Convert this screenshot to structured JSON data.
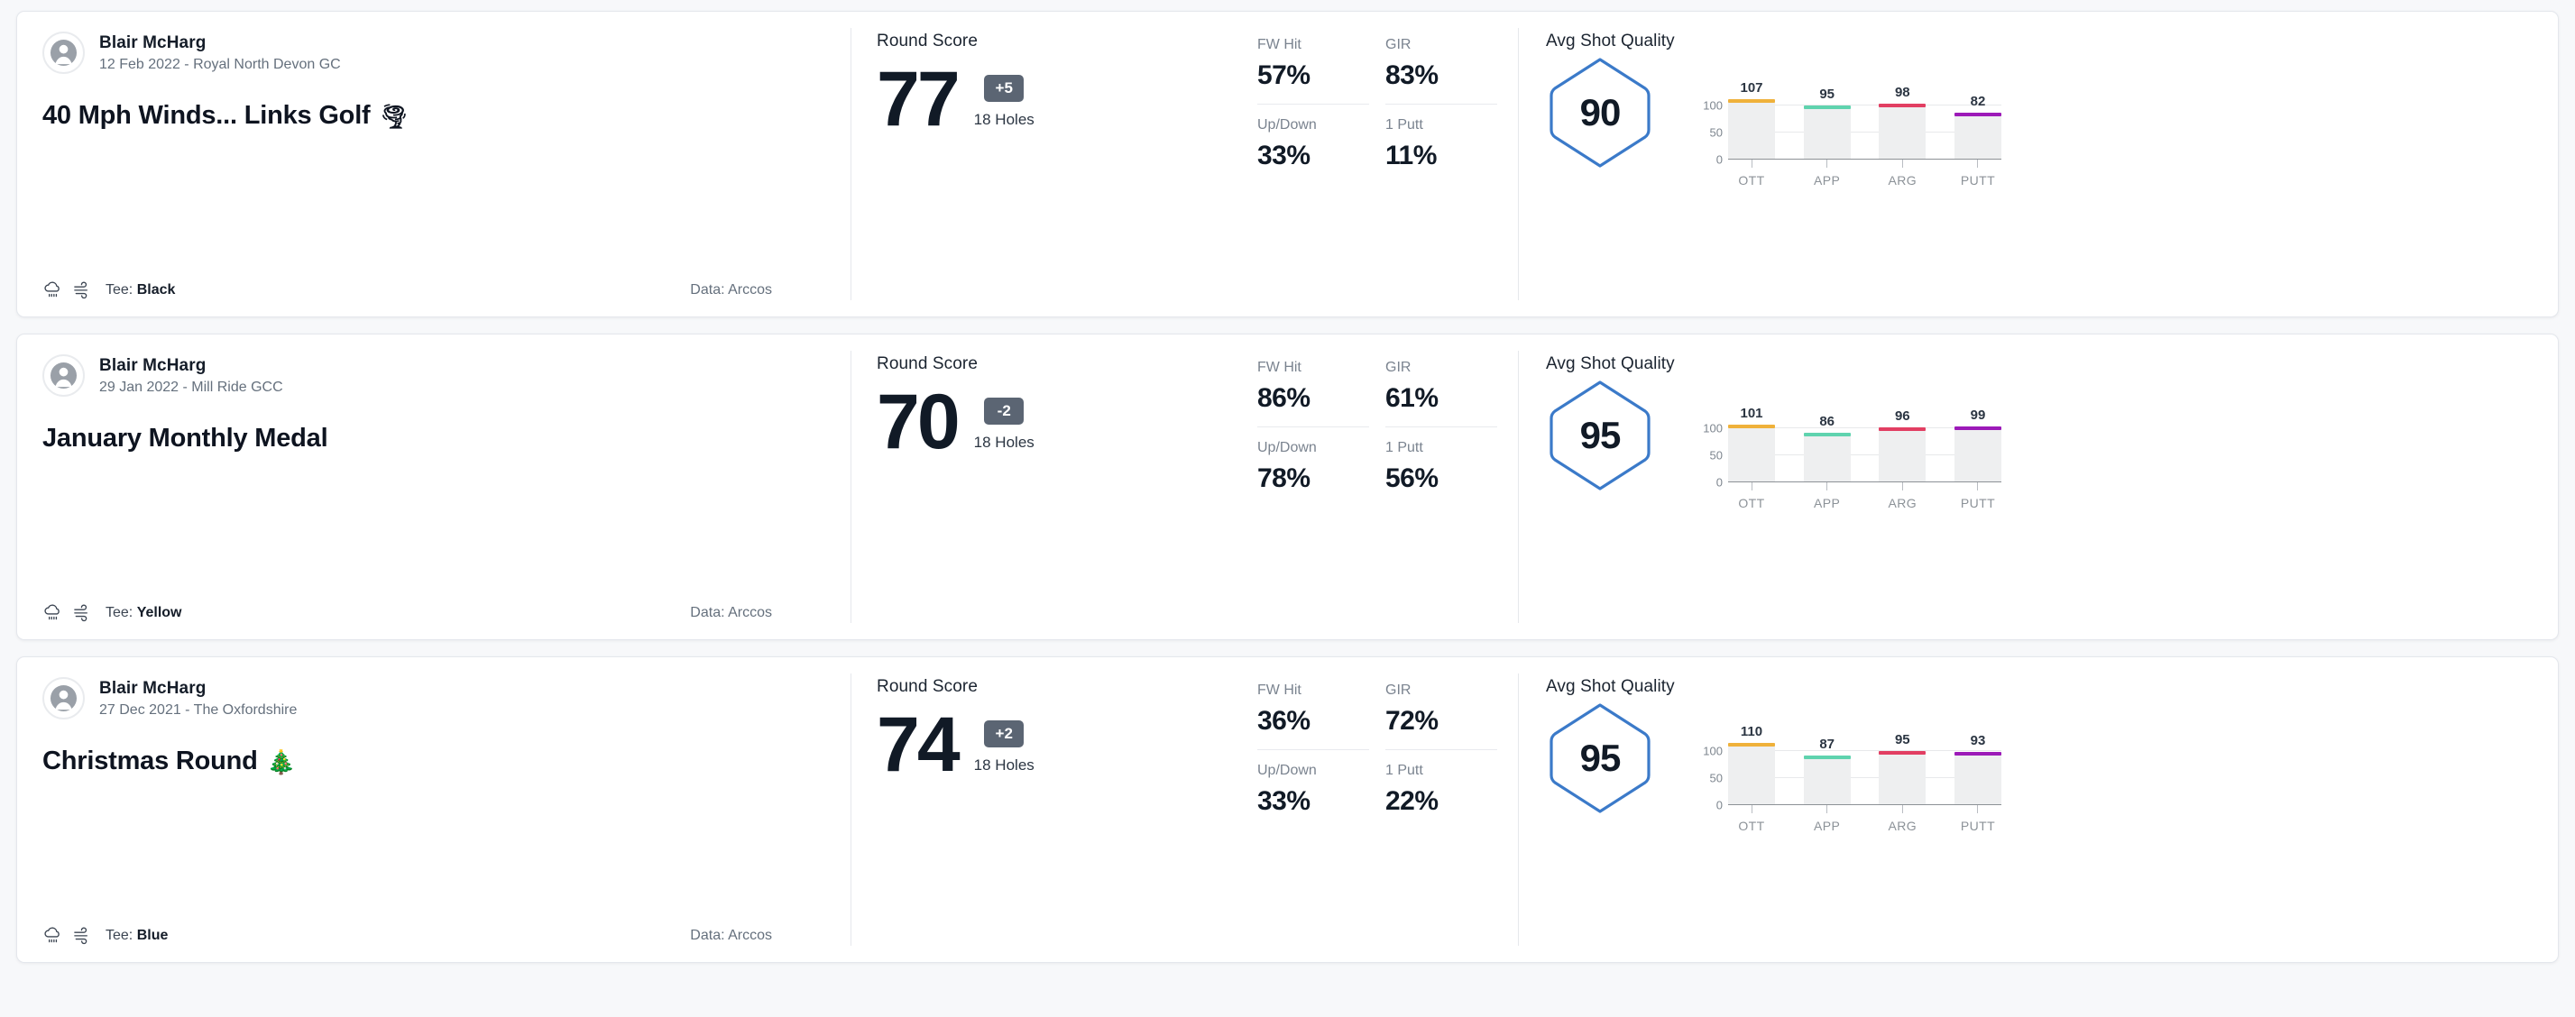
{
  "colors": {
    "hex_stroke": "#3b7ac9",
    "badge_bg": "#5b6573",
    "bar_track": "#eeeff0",
    "ott": "#efb13a",
    "app": "#5fd3ae",
    "arg": "#e23e62",
    "putt": "#9c1ab8"
  },
  "labels": {
    "round_score": "Round Score",
    "avg_shot_quality": "Avg Shot Quality",
    "holes": "18 Holes",
    "tee_prefix": "Tee:",
    "data_source": "Data: Arccos",
    "fw_hit": "FW Hit",
    "gir": "GIR",
    "up_down": "Up/Down",
    "one_putt": "1 Putt"
  },
  "chart_axis": {
    "y_ticks": [
      "100",
      "50",
      "0"
    ],
    "y_max": 130,
    "categories": [
      "OTT",
      "APP",
      "ARG",
      "PUTT"
    ]
  },
  "rounds": [
    {
      "user": "Blair McHarg",
      "subtitle": "12 Feb 2022 - Royal North Devon GC",
      "title": "40 Mph Winds... Links Golf",
      "title_emoji": "🌪",
      "tee": "Black",
      "data_source": "Data: Arccos",
      "score": "77",
      "to_par": "+5",
      "holes": "18 Holes",
      "stats": {
        "fw_hit": "57%",
        "gir": "83%",
        "up_down": "33%",
        "one_putt": "11%"
      },
      "shot_quality": "90",
      "chart_data": {
        "type": "bar",
        "title": "Avg Shot Quality",
        "categories": [
          "OTT",
          "APP",
          "ARG",
          "PUTT"
        ],
        "values": [
          107,
          95,
          98,
          82
        ],
        "colors": [
          "#efb13a",
          "#5fd3ae",
          "#e23e62",
          "#9c1ab8"
        ],
        "ylim": [
          0,
          130
        ],
        "yticks": [
          0,
          50,
          100
        ],
        "xlabel": "",
        "ylabel": "",
        "grid": true,
        "legend": "none"
      }
    },
    {
      "user": "Blair McHarg",
      "subtitle": "29 Jan 2022 - Mill Ride GCC",
      "title": "January Monthly Medal",
      "title_emoji": "",
      "tee": "Yellow",
      "data_source": "Data: Arccos",
      "score": "70",
      "to_par": "-2",
      "holes": "18 Holes",
      "stats": {
        "fw_hit": "86%",
        "gir": "61%",
        "up_down": "78%",
        "one_putt": "56%"
      },
      "shot_quality": "95",
      "chart_data": {
        "type": "bar",
        "title": "Avg Shot Quality",
        "categories": [
          "OTT",
          "APP",
          "ARG",
          "PUTT"
        ],
        "values": [
          101,
          86,
          96,
          99
        ],
        "colors": [
          "#efb13a",
          "#5fd3ae",
          "#e23e62",
          "#9c1ab8"
        ],
        "ylim": [
          0,
          130
        ],
        "yticks": [
          0,
          50,
          100
        ],
        "xlabel": "",
        "ylabel": "",
        "grid": true,
        "legend": "none"
      }
    },
    {
      "user": "Blair McHarg",
      "subtitle": "27 Dec 2021 - The Oxfordshire",
      "title": "Christmas Round",
      "title_emoji": "🎄",
      "tee": "Blue",
      "data_source": "Data: Arccos",
      "score": "74",
      "to_par": "+2",
      "holes": "18 Holes",
      "stats": {
        "fw_hit": "36%",
        "gir": "72%",
        "up_down": "33%",
        "one_putt": "22%"
      },
      "shot_quality": "95",
      "chart_data": {
        "type": "bar",
        "title": "Avg Shot Quality",
        "categories": [
          "OTT",
          "APP",
          "ARG",
          "PUTT"
        ],
        "values": [
          110,
          87,
          95,
          93
        ],
        "colors": [
          "#efb13a",
          "#5fd3ae",
          "#e23e62",
          "#9c1ab8"
        ],
        "ylim": [
          0,
          130
        ],
        "yticks": [
          0,
          50,
          100
        ],
        "xlabel": "",
        "ylabel": "",
        "grid": true,
        "legend": "none"
      }
    }
  ]
}
